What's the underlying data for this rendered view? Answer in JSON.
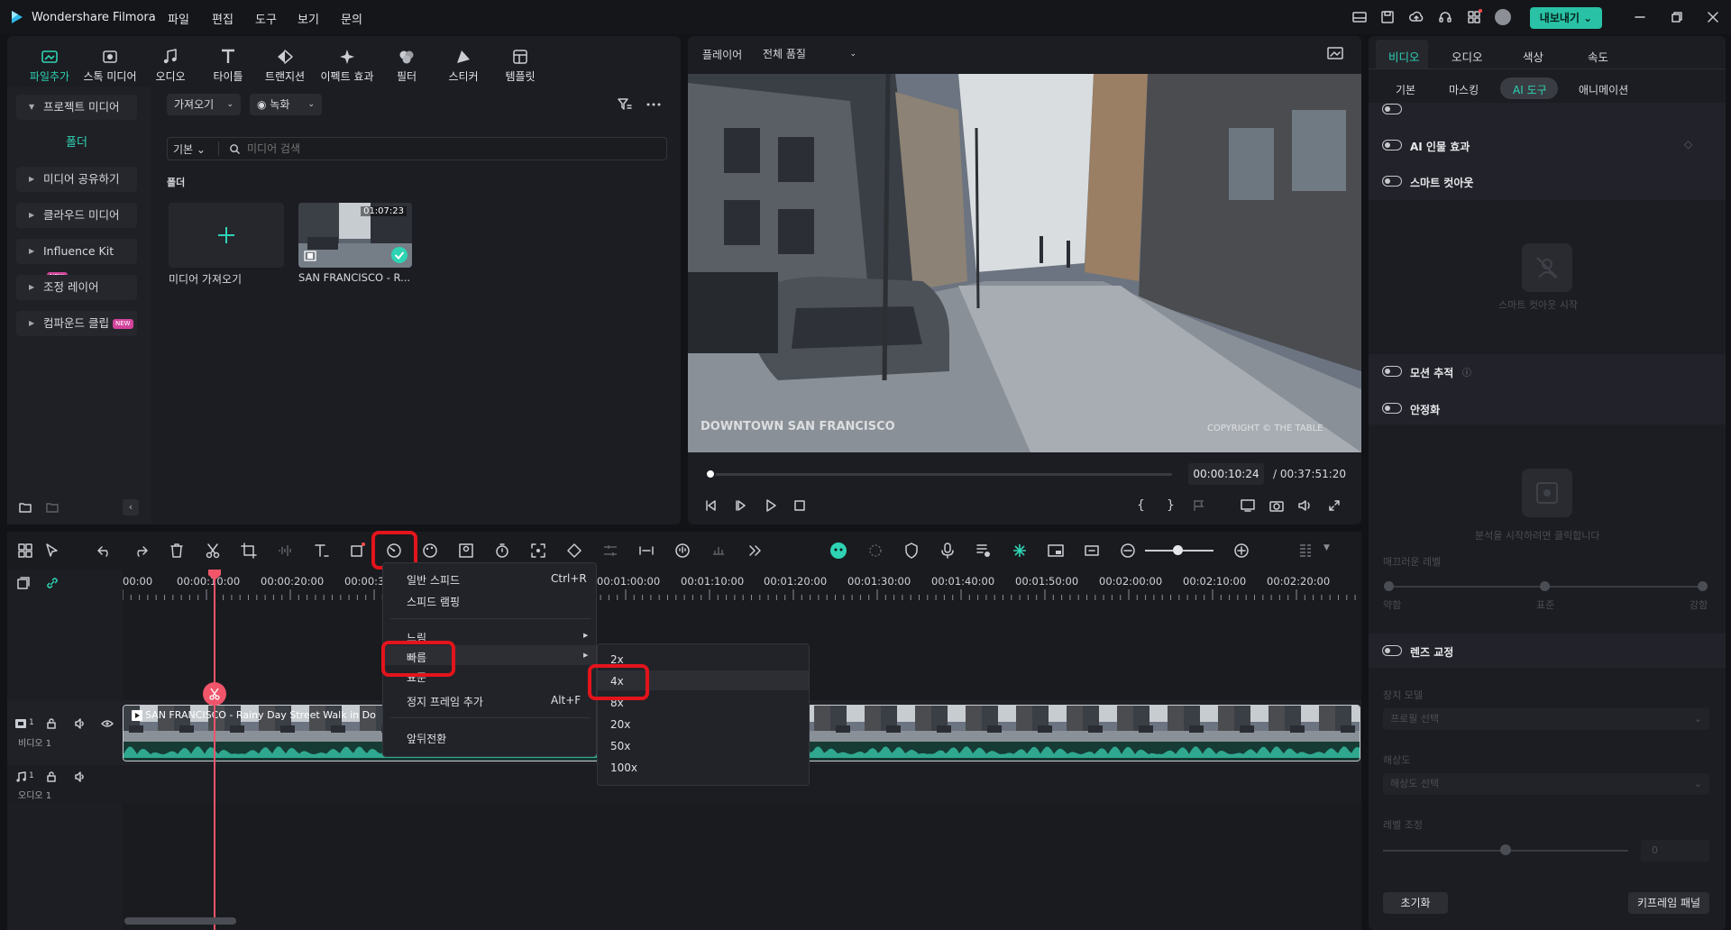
{
  "app": {
    "name": "Wondershare Filmora"
  },
  "menubar": [
    "파일",
    "편집",
    "도구",
    "보기",
    "문의"
  ],
  "export_label": "내보내기",
  "toolbar_tabs": [
    {
      "label": "파일추가",
      "icon": "import-icon",
      "active": true
    },
    {
      "label": "스톡 미디어",
      "icon": "stock-media-icon"
    },
    {
      "label": "오디오",
      "icon": "music-note-icon"
    },
    {
      "label": "타이틀",
      "icon": "title-t-icon"
    },
    {
      "label": "트랜지션",
      "icon": "transition-icon"
    },
    {
      "label": "이펙트 효과",
      "icon": "effects-sparkle-icon"
    },
    {
      "label": "필터",
      "icon": "filter-icon"
    },
    {
      "label": "스티커",
      "icon": "sticker-icon"
    },
    {
      "label": "템플릿",
      "icon": "template-icon"
    }
  ],
  "sidebar": {
    "project_media": "프로젝트 미디어",
    "folder": "폴더",
    "items": [
      "미디어 공유하기",
      "클라우드 미디어",
      "Influence Kit",
      "조정 레이어",
      "컴파운드 클립"
    ],
    "new_badge": "NEW"
  },
  "media": {
    "import_dropdown": "가져오기",
    "record_dropdown": "녹화",
    "view_dropdown": "기본",
    "search_placeholder": "미디어 검색",
    "folder_label": "폴더",
    "import_card_label": "미디어 가져오기",
    "clip": {
      "name": "SAN FRANCISCO - R...",
      "duration": "01:07:23"
    }
  },
  "player": {
    "label": "플레이어",
    "quality": "전체 품질",
    "watermark_left": "DOWNTOWN SAN FRANCISCO",
    "watermark_right": "COPYRIGHT © THE TABLE",
    "current_time": "00:00:10:24",
    "total_time": "/ 00:37:51:20",
    "progress": 0.005
  },
  "props": {
    "tabs": [
      "비디오",
      "오디오",
      "색상",
      "속도"
    ],
    "active_tab": "비디오",
    "subtabs": [
      "기본",
      "마스킹",
      "AI 도구",
      "애니메이션"
    ],
    "active_subtab": "AI 도구",
    "rows": {
      "portrait": "AI 인물 효과",
      "smart_cutout": "스마트 컷아웃",
      "smart_cutout_start": "스마트 컷아웃 시작",
      "motion_tracking": "모션 추적",
      "stabilize": "안정화",
      "analyze_hint": "분석을 시작하려면 클릭합니다",
      "smoothness": "매끄러운 레벨",
      "weak": "약함",
      "normal": "표준",
      "strong": "강함",
      "lens_correction": "렌즈 교정",
      "device_model": "장치 모델",
      "profile_select": "프로필 선택",
      "resolution": "해상도",
      "resolution_select": "해상도 선택",
      "level_adjust": "레벨 조정",
      "level_value": "0"
    },
    "reset": "초기화",
    "keyframe_panel": "키프레임 패널"
  },
  "timeline": {
    "ruler": [
      "00:00",
      "00:00:10:00",
      "00:00:20:00",
      "00:00:30:00",
      "00:01:00:00",
      "00:01:10:00",
      "00:01:20:00",
      "00:01:30:00",
      "00:01:40:00",
      "00:01:50:00",
      "00:02:00:00",
      "00:02:10:00",
      "00:02:20:00"
    ],
    "video_track": "비디오 1",
    "audio_track": "오디오 1",
    "clip_title": "SAN FRANCISCO - Rainy Day Street Walk in Do"
  },
  "context_menu": {
    "items": [
      {
        "label": "일반 스피드",
        "shortcut": "Ctrl+R"
      },
      {
        "label": "스피드 램핑",
        "shortcut": ""
      },
      {
        "label": "느림",
        "shortcut": ""
      },
      {
        "label": "빠름",
        "shortcut": ""
      },
      {
        "label": "표준",
        "shortcut": ""
      },
      {
        "label": "정지 프레임 추가",
        "shortcut": "Alt+F"
      },
      {
        "label": "앞뒤전환",
        "shortcut": ""
      }
    ],
    "submenu": [
      "2x",
      "4x",
      "8x",
      "20x",
      "50x",
      "100x"
    ]
  },
  "colors": {
    "accent": "#2ED3B3",
    "highlight": "#E3141C",
    "playhead": "#F0556A"
  }
}
